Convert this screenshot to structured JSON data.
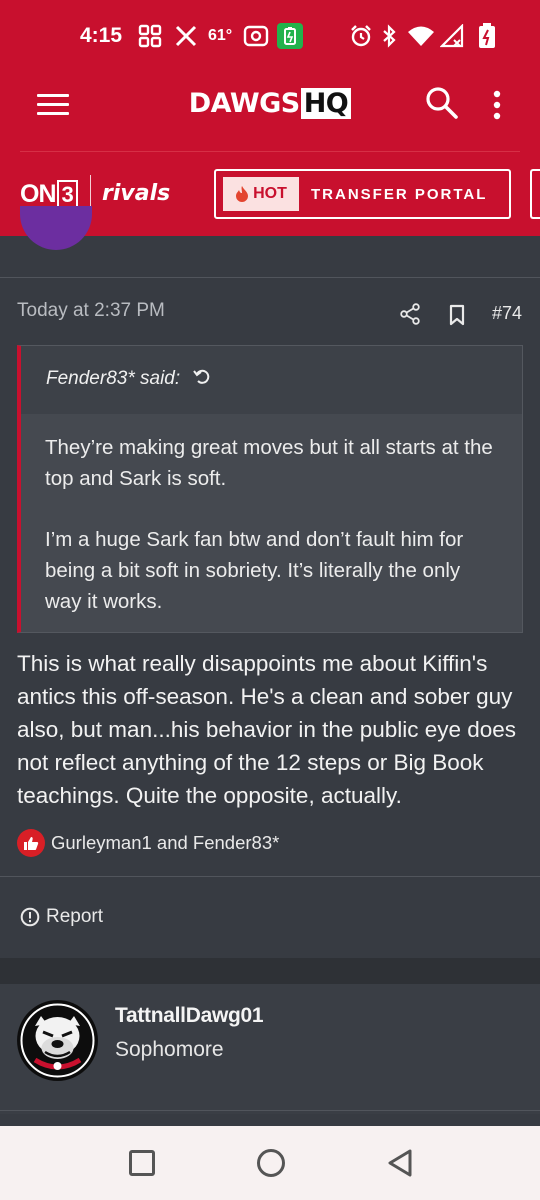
{
  "status_bar": {
    "time": "4:15",
    "temperature": "61°",
    "icons": [
      "grid-icon",
      "x-logo-icon",
      "radio-icon",
      "battery-saver-icon",
      "alarm-icon",
      "bluetooth-icon",
      "wifi-icon",
      "signal-icon",
      "battery-charging-icon"
    ]
  },
  "header": {
    "logo_main": "DAWGS",
    "logo_suffix": "HQ",
    "icons": [
      "menu-hamburger-icon",
      "search-icon",
      "more-vertical-icon"
    ],
    "accent_color": "#c8102e"
  },
  "brand_bar": {
    "on3_text": "ON",
    "on3_digit": "3",
    "rivals": "rivals",
    "hot_label": "HOT",
    "portal_label": "TRANSFER PORTAL"
  },
  "post": {
    "date": "Today at 2:37 PM",
    "number": "#74",
    "quote": {
      "author_line": "Fender83* said:",
      "paragraphs": [
        "They’re making great moves but it all starts at the top and Sark is soft.",
        "I’m a huge Sark fan btw and don’t fault him for being a bit soft in sobriety. It’s literally the only way it works."
      ]
    },
    "body": "This is what really disappoints me about Kiffin's antics this off-season. He's a clean and sober guy also, but man...his behavior in the public eye does not reflect anything of the 12 steps or Big Book teachings. Quite the opposite, actually.",
    "likes_text": "Gurleyman1 and Fender83*",
    "report_label": "Report"
  },
  "next_user": {
    "username": "TattnallDawg01",
    "title": "Sophomore"
  },
  "nav_bar": {
    "icons": [
      "recents-square-icon",
      "home-circle-icon",
      "back-triangle-icon"
    ]
  }
}
